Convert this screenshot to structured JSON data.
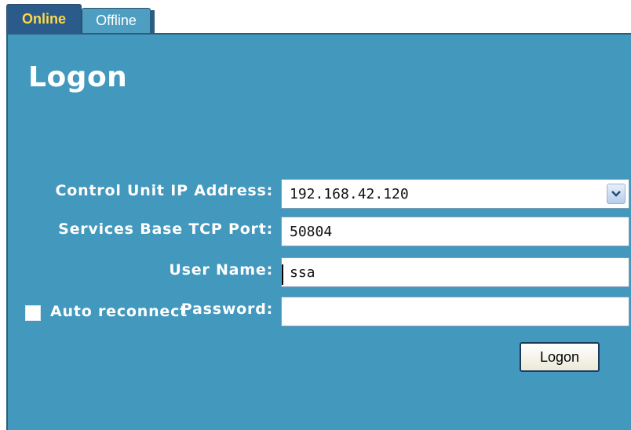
{
  "tabs": [
    {
      "label": "Online",
      "active": true
    },
    {
      "label": "Offline",
      "active": false
    }
  ],
  "title": "Logon",
  "fields": {
    "ip": {
      "label": "Control Unit IP Address:",
      "value": "192.168.42.120"
    },
    "port": {
      "label": "Services Base TCP Port:",
      "value": "50804"
    },
    "username": {
      "label": "User Name:",
      "value": "ssa"
    },
    "password": {
      "label": "Password:",
      "value": ""
    }
  },
  "auto_reconnect": {
    "label": "Auto reconnect",
    "checked": false
  },
  "logon_button": "Logon",
  "icons": {
    "dropdown": "chevron-down-icon"
  },
  "colors": {
    "panel": "#4298bd",
    "active_tab": "#2a5b8a",
    "active_tab_text": "#ffd84a",
    "inactive_tab": "#4e9ec1"
  }
}
